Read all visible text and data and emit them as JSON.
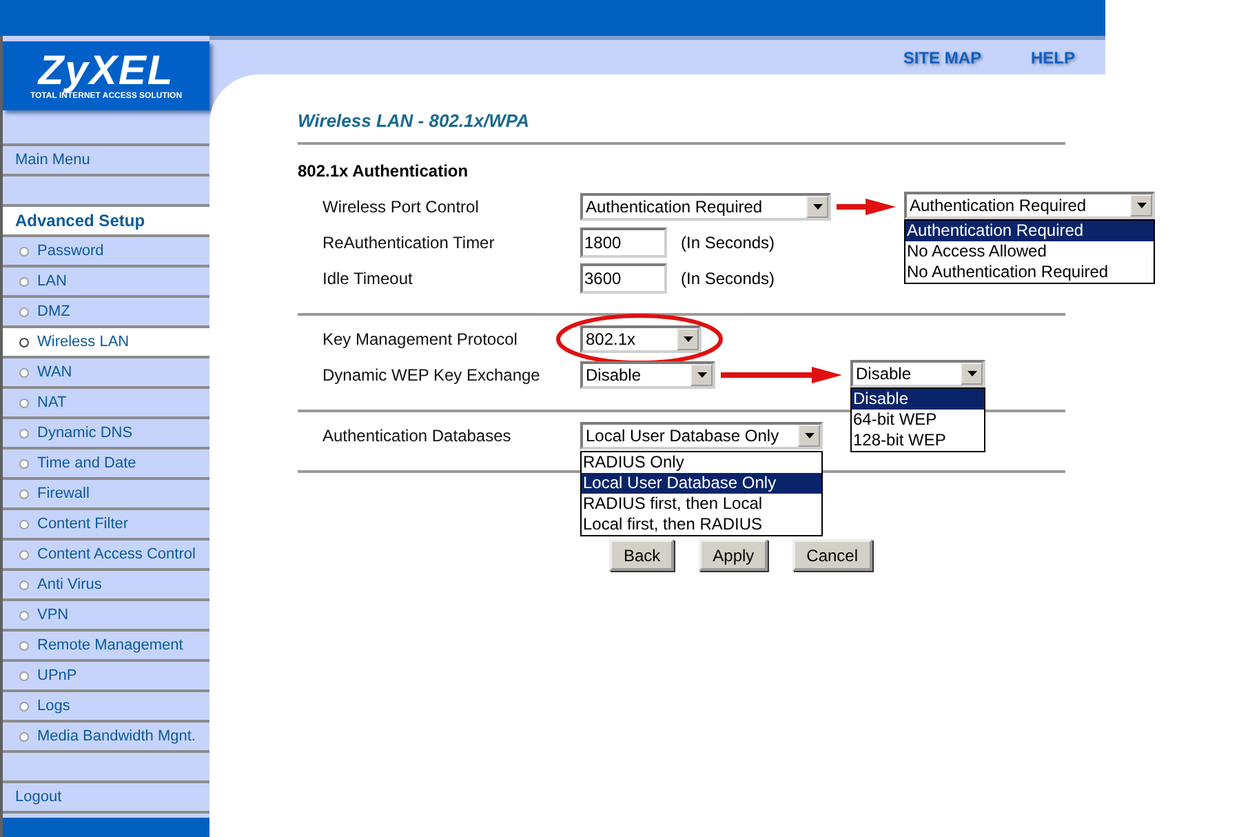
{
  "header": {
    "brand": "ZyXEL",
    "tagline": "TOTAL INTERNET ACCESS SOLUTION",
    "links": [
      "SITE MAP",
      "HELP"
    ]
  },
  "sidebar": {
    "items": [
      {
        "label": "Main Menu",
        "kind": "top",
        "selected": false
      },
      {
        "kind": "spacer"
      },
      {
        "label": "Advanced Setup",
        "kind": "heading"
      },
      {
        "label": "Password",
        "kind": "sub",
        "selected": false
      },
      {
        "label": "LAN",
        "kind": "sub",
        "selected": false
      },
      {
        "label": "DMZ",
        "kind": "sub",
        "selected": false
      },
      {
        "label": "Wireless LAN",
        "kind": "sub",
        "selected": true
      },
      {
        "label": "WAN",
        "kind": "sub",
        "selected": false
      },
      {
        "label": "NAT",
        "kind": "sub",
        "selected": false
      },
      {
        "label": "Dynamic DNS",
        "kind": "sub",
        "selected": false
      },
      {
        "label": "Time and Date",
        "kind": "sub",
        "selected": false
      },
      {
        "label": "Firewall",
        "kind": "sub",
        "selected": false
      },
      {
        "label": "Content Filter",
        "kind": "sub",
        "selected": false
      },
      {
        "label": "Content Access Control",
        "kind": "sub",
        "selected": false
      },
      {
        "label": "Anti Virus",
        "kind": "sub",
        "selected": false
      },
      {
        "label": "VPN",
        "kind": "sub",
        "selected": false
      },
      {
        "label": "Remote Management",
        "kind": "sub",
        "selected": false
      },
      {
        "label": "UPnP",
        "kind": "sub",
        "selected": false
      },
      {
        "label": "Logs",
        "kind": "sub",
        "selected": false
      },
      {
        "label": "Media Bandwidth Mgnt.",
        "kind": "sub",
        "selected": false
      },
      {
        "kind": "spacer"
      },
      {
        "label": "Logout",
        "kind": "top",
        "selected": false
      }
    ]
  },
  "page_title": "Wireless LAN - 802.1x/WPA",
  "section_title": "802.1x Authentication",
  "groups": [
    {
      "fields": [
        {
          "kind": "select",
          "label": "Wireless Port Control",
          "value": "Authentication Required",
          "popup": {
            "value": "Authentication Required",
            "options": [
              {
                "label": "Authentication Required",
                "selected": true
              },
              {
                "label": "No Access Allowed",
                "selected": false
              },
              {
                "label": "No Authentication Required",
                "selected": false
              }
            ]
          }
        },
        {
          "kind": "text",
          "label": "ReAuthentication Timer",
          "value": "1800",
          "unit": "(In Seconds)"
        },
        {
          "kind": "text",
          "label": "Idle Timeout",
          "value": "3600",
          "unit": "(In Seconds)"
        }
      ]
    },
    {
      "fields": [
        {
          "kind": "select",
          "label": "Key Management Protocol",
          "value": "802.1x",
          "circled": true
        },
        {
          "kind": "select",
          "label": "Dynamic WEP Key Exchange",
          "value": "Disable",
          "popup": {
            "value": "Disable",
            "options": [
              {
                "label": "Disable",
                "selected": true
              },
              {
                "label": "64-bit WEP",
                "selected": false
              },
              {
                "label": "128-bit WEP",
                "selected": false
              }
            ]
          }
        }
      ]
    },
    {
      "fields": [
        {
          "kind": "select",
          "label": "Authentication Databases",
          "value": "Local User Database Only",
          "open_list": [
            {
              "label": "RADIUS Only",
              "selected": false
            },
            {
              "label": "Local User Database Only",
              "selected": true
            },
            {
              "label": "RADIUS first, then Local",
              "selected": false
            },
            {
              "label": "Local first, then RADIUS",
              "selected": false
            }
          ]
        }
      ]
    }
  ],
  "buttons": [
    "Back",
    "Apply",
    "Cancel"
  ]
}
